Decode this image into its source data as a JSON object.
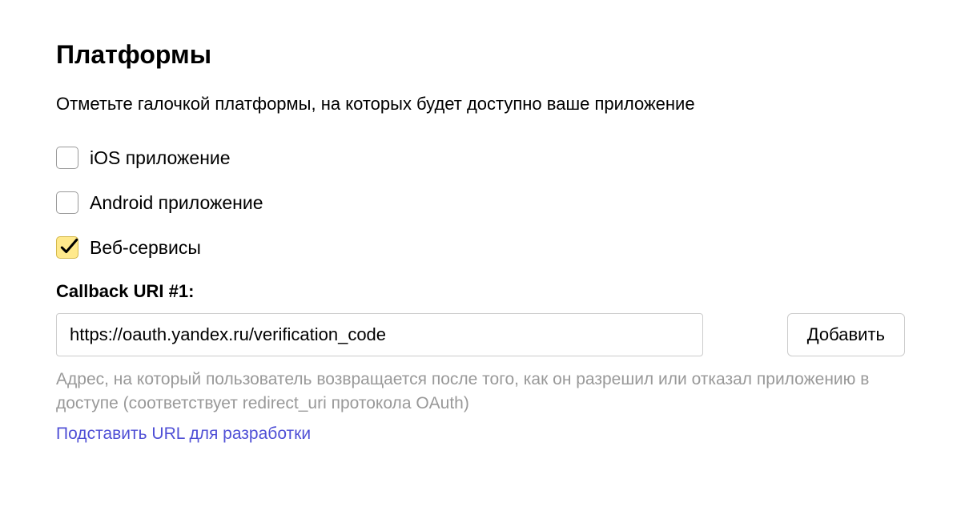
{
  "section": {
    "title": "Платформы",
    "description": "Отметьте галочкой платформы, на которых будет доступно ваше приложение"
  },
  "platforms": [
    {
      "label": "iOS приложение",
      "checked": false
    },
    {
      "label": "Android приложение",
      "checked": false
    },
    {
      "label": "Веб-сервисы",
      "checked": true
    }
  ],
  "callback": {
    "label": "Callback URI #1:",
    "value": "https://oauth.yandex.ru/verification_code",
    "add_label": "Добавить",
    "help_text": "Адрес, на который пользователь возвращается после того, как он разрешил или отказал приложению в доступе (соответствует redirect_uri протокола OAuth)",
    "dev_url_link": "Подставить URL для разработки"
  }
}
